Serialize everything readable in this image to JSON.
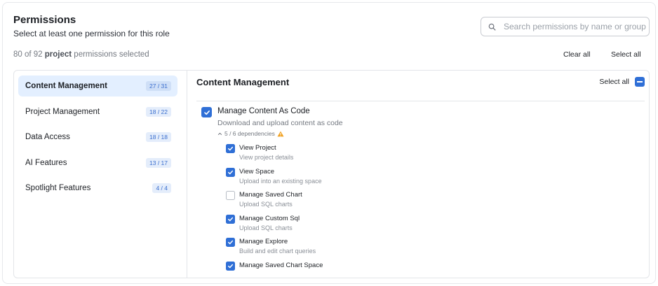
{
  "header": {
    "title": "Permissions",
    "subtitle": "Select at least one permission for this role"
  },
  "search": {
    "placeholder": "Search permissions by name or group",
    "value": "",
    "icon": "search-icon"
  },
  "summary": {
    "prefix": "80 of 92 ",
    "scope": "project",
    "suffix": " permissions selected",
    "clear_all_label": "Clear all",
    "select_all_label": "Select all"
  },
  "sidebar": {
    "items": [
      {
        "label": "Content Management",
        "count": "27 / 31",
        "active": true
      },
      {
        "label": "Project Management",
        "count": "18 / 22",
        "active": false
      },
      {
        "label": "Data Access",
        "count": "18 / 18",
        "active": false
      },
      {
        "label": "AI Features",
        "count": "13 / 17",
        "active": false
      },
      {
        "label": "Spotlight Features",
        "count": "4 / 4",
        "active": false
      }
    ]
  },
  "main": {
    "title": "Content Management",
    "select_all_label": "Select all",
    "permission": {
      "name": "Manage Content As Code",
      "description": "Download and upload content as code",
      "dependencies_label": "5 / 6 dependencies",
      "checked": true
    },
    "dependencies": [
      {
        "name": "View Project",
        "description": "View project details",
        "checked": true
      },
      {
        "name": "View Space",
        "description": "Upload into an existing space",
        "checked": true
      },
      {
        "name": "Manage Saved Chart",
        "description": "Upload SQL charts",
        "checked": false
      },
      {
        "name": "Manage Custom Sql",
        "description": "Upload SQL charts",
        "checked": true
      },
      {
        "name": "Manage Explore",
        "description": "Build and edit chart queries",
        "checked": true
      },
      {
        "name": "Manage Saved Chart Space",
        "description": "",
        "checked": true
      }
    ]
  },
  "colors": {
    "accent": "#2f6fd6",
    "active_bg": "#e3efff",
    "warning": "#f0a020"
  }
}
